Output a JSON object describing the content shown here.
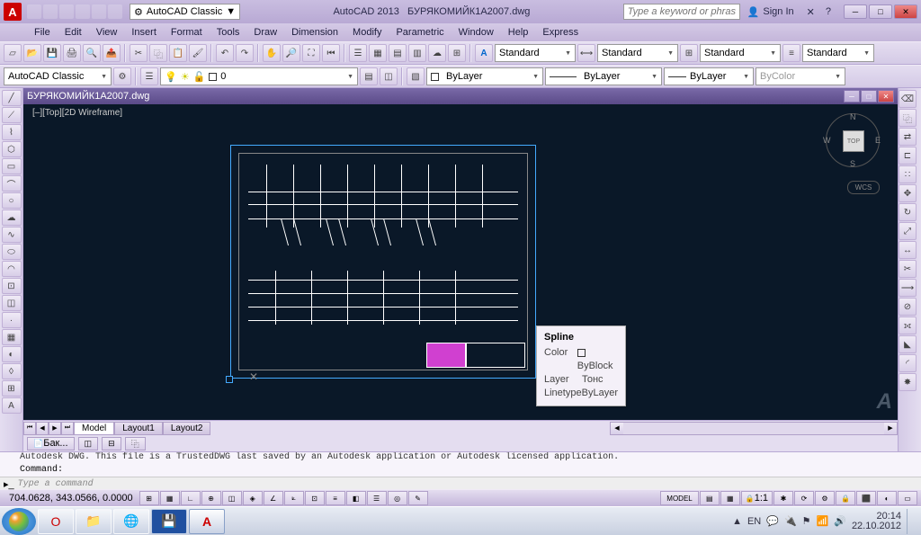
{
  "title": {
    "app": "AutoCAD 2013",
    "file": "БУРЯКОМИЙК1A2007.dwg"
  },
  "workspace": "AutoCAD Classic",
  "search_placeholder": "Type a keyword or phrase",
  "signin": "Sign In",
  "menus": [
    "File",
    "Edit",
    "View",
    "Insert",
    "Format",
    "Tools",
    "Draw",
    "Dimension",
    "Modify",
    "Parametric",
    "Window",
    "Help",
    "Express"
  ],
  "styles": {
    "text": "Standard",
    "dim": "Standard",
    "table": "Standard",
    "ml": "Standard"
  },
  "layers": {
    "layer": "ByLayer",
    "lw": "ByLayer",
    "lt": "ByLayer",
    "color": "ByColor"
  },
  "workspace_selector": "AutoCAD Classic",
  "doc_tab": "БУРЯКОМИЙК1A2007.dwg",
  "wireframe": "[–][Top][2D Wireframe]",
  "viewcube": {
    "face": "TOP",
    "n": "N",
    "s": "S",
    "e": "E",
    "w": "W",
    "wcs": "WCS"
  },
  "tooltip": {
    "title": "Spline",
    "rows": [
      {
        "k": "Color",
        "v": "ByBlock",
        "swatch": true
      },
      {
        "k": "Layer",
        "v": "Тонс"
      },
      {
        "k": "Linetype",
        "v": "ByLayer"
      }
    ]
  },
  "tabs": {
    "model": "Model",
    "l1": "Layout1",
    "l2": "Layout2"
  },
  "footer_btn": "Бак...",
  "cmd": {
    "log": "Autodesk DWG.  This file is a TrustedDWG last saved by an Autodesk application or Autodesk licensed application.",
    "prompt": "Command:",
    "placeholder": "Type a command"
  },
  "status": {
    "coords": "704.0628, 343.0566, 0.0000",
    "model": "MODEL",
    "scale": "1:1",
    "lang": "EN"
  },
  "taskbar": {
    "time": "20:14",
    "date": "22.10.2012"
  }
}
